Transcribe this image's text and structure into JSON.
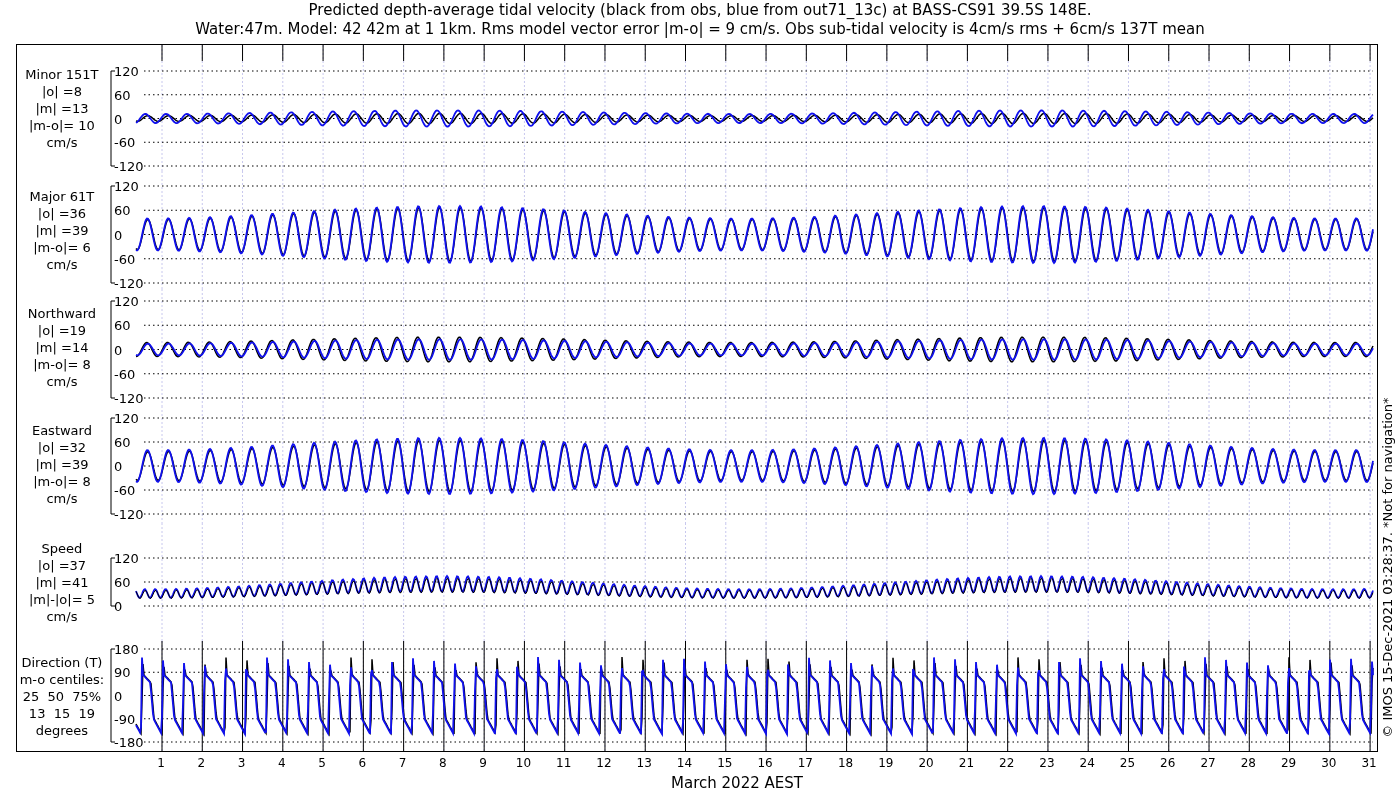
{
  "title_lines": [
    "Predicted depth-average tidal velocity (black from obs, blue from out71_13c) at BASS-CS91 39.5S 148E.",
    "Water:47m. Model: 42 42m at 1 1km. Rms model vector error |m-o| = 9 cm/s. Obs sub-tidal velocity is 4cm/s rms + 6cm/s 137T mean"
  ],
  "panels": [
    {
      "kind": "minor",
      "label_lines": [
        "Minor 151T",
        "|o| =8",
        "|m| =13",
        "|m-o|= 10",
        "cm/s"
      ],
      "yticks": [
        "120",
        "60",
        "0",
        "-60",
        "-120"
      ]
    },
    {
      "kind": "major",
      "label_lines": [
        "Major 61T",
        "|o| =36",
        "|m| =39",
        "|m-o|= 6",
        "cm/s"
      ],
      "yticks": [
        "120",
        "60",
        "0",
        "-60",
        "-120"
      ]
    },
    {
      "kind": "northward",
      "label_lines": [
        "Northward",
        "|o| =19",
        "|m| =14",
        "|m-o|= 8",
        "cm/s"
      ],
      "yticks": [
        "120",
        "60",
        "0",
        "-60",
        "-120"
      ]
    },
    {
      "kind": "eastward",
      "label_lines": [
        "Eastward",
        "|o| =32",
        "|m| =39",
        "|m-o|= 8",
        "cm/s"
      ],
      "yticks": [
        "120",
        "60",
        "0",
        "-60",
        "-120"
      ]
    },
    {
      "kind": "speed",
      "label_lines": [
        "Speed",
        "|o| =37",
        "|m| =41",
        "|m|-|o|= 5",
        "cm/s"
      ],
      "yticks": [
        "120",
        "60",
        "0"
      ]
    },
    {
      "kind": "direction",
      "label_lines": [
        "Direction (T)",
        "m-o centiles:",
        "25  50  75%",
        "13  15  19",
        "degrees"
      ],
      "yticks": [
        "180",
        "90",
        "0",
        "-90",
        "-180"
      ]
    }
  ],
  "xticks": [
    "1",
    "2",
    "3",
    "4",
    "5",
    "6",
    "7",
    "8",
    "9",
    "10",
    "11",
    "12",
    "13",
    "14",
    "15",
    "16",
    "17",
    "18",
    "19",
    "20",
    "21",
    "22",
    "23",
    "24",
    "25",
    "26",
    "27",
    "28",
    "29",
    "30",
    "31"
  ],
  "xlabel": "March 2022 AEST",
  "side_note": "© IMOS 15-Dec-2021 03:28:37. *Not for navigation*"
}
